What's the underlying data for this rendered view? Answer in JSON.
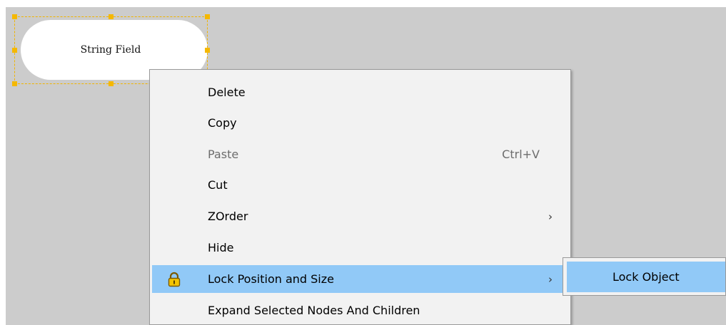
{
  "canvas": {
    "background": "#cccccc"
  },
  "node": {
    "label": "String Field",
    "selection_color": "#f5b800"
  },
  "context_menu": {
    "items": [
      {
        "label": "Delete"
      },
      {
        "label": "Copy"
      },
      {
        "label": "Paste",
        "shortcut": "Ctrl+V",
        "disabled": true
      },
      {
        "label": "Cut"
      },
      {
        "label": "ZOrder",
        "submenu_arrow": "›"
      },
      {
        "label": "Hide"
      },
      {
        "label": "Lock Position and Size",
        "icon": "lock-icon",
        "submenu_arrow": "›",
        "highlighted": true
      },
      {
        "label": "Expand Selected Nodes And Children"
      }
    ],
    "highlight_color": "#91c9f7"
  },
  "submenu": {
    "items": [
      {
        "label": "Lock Object",
        "highlighted": true
      }
    ]
  }
}
